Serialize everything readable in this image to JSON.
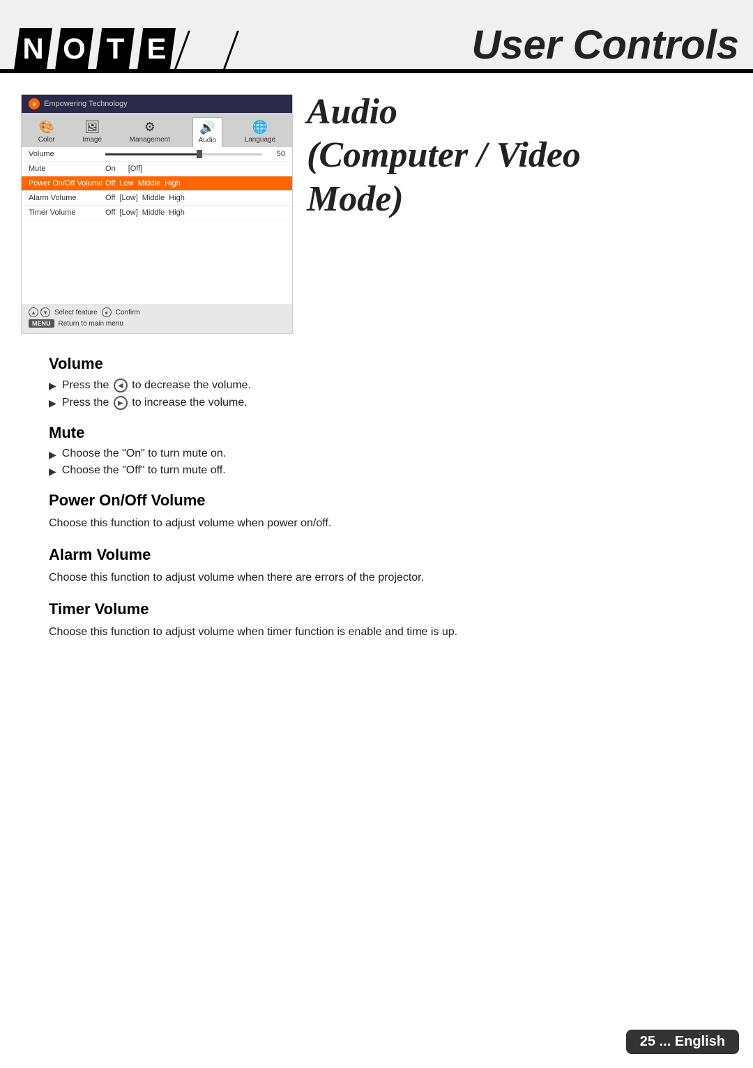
{
  "header": {
    "logo_letters": [
      "N",
      "O",
      "T",
      "E"
    ],
    "title": "User Controls"
  },
  "osd": {
    "header_logo": "e",
    "header_text": "Empowering Technology",
    "tabs": [
      {
        "icon": "🎨",
        "label": "Color"
      },
      {
        "icon": "🖼",
        "label": "Image"
      },
      {
        "icon": "⚙",
        "label": "Management"
      },
      {
        "icon": "🔊",
        "label": "Audio",
        "active": true
      },
      {
        "icon": "🌐",
        "label": "Language"
      }
    ],
    "rows": [
      {
        "label": "Volume",
        "type": "slider",
        "value": "50",
        "highlight": false
      },
      {
        "label": "Mute",
        "type": "options",
        "options": [
          "On",
          "[Off]"
        ],
        "highlight": false
      },
      {
        "label": "Power On/Off Volume",
        "type": "options",
        "options": [
          "Off",
          "Low",
          "Middle",
          "High"
        ],
        "highlight": true
      },
      {
        "label": "Alarm Volume",
        "type": "options",
        "options": [
          "Off",
          "[Low]",
          "Middle",
          "High"
        ],
        "highlight": false
      },
      {
        "label": "Timer Volume",
        "type": "options",
        "options": [
          "Off",
          "[Low]",
          "Middle",
          "High"
        ],
        "highlight": false
      }
    ],
    "footer": {
      "select_label": "Select feature",
      "confirm_label": "Confirm",
      "menu_label": "MENU",
      "menu_text": "Return to main menu"
    }
  },
  "mode_title": "Audio (Computer / Video Mode)",
  "sections": [
    {
      "id": "volume",
      "title": "Volume",
      "bullets": [
        {
          "text_before": "Press the",
          "icon": "left-arrow",
          "text_after": "to decrease the volume."
        },
        {
          "text_before": "Press the",
          "icon": "right-arrow",
          "text_after": "to increase the volume."
        }
      ]
    },
    {
      "id": "mute",
      "title": "Mute",
      "bullets": [
        {
          "text": "Choose the “On” to turn mute on."
        },
        {
          "text": "Choose the “Off” to turn mute off."
        }
      ]
    },
    {
      "id": "power-volume",
      "title": "Power On/Off Volume",
      "body": "Choose this function to adjust volume when power on/off."
    },
    {
      "id": "alarm-volume",
      "title": "Alarm Volume",
      "body": "Choose this function to adjust volume when there are errors of the projector."
    },
    {
      "id": "timer-volume",
      "title": "Timer Volume",
      "body": "Choose this function to adjust volume when timer function is enable and time is up."
    }
  ],
  "footer": {
    "page_number": "25",
    "language": "... English"
  }
}
